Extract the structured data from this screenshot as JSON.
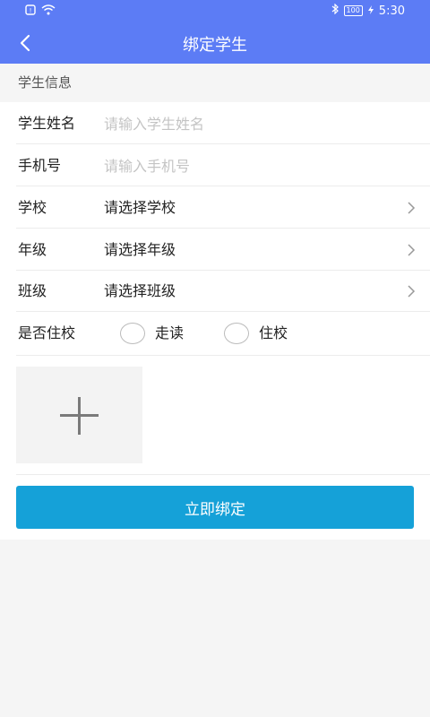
{
  "status_bar": {
    "battery": "100",
    "time": "5:30"
  },
  "nav": {
    "title": "绑定学生"
  },
  "section": {
    "title": "学生信息"
  },
  "form": {
    "name": {
      "label": "学生姓名",
      "placeholder": "请输入学生姓名"
    },
    "phone": {
      "label": "手机号",
      "placeholder": "请输入手机号"
    },
    "school": {
      "label": "学校",
      "value": "请选择学校"
    },
    "grade": {
      "label": "年级",
      "value": "请选择年级"
    },
    "class": {
      "label": "班级",
      "value": "请选择班级"
    },
    "boarding": {
      "label": "是否住校",
      "options": [
        "走读",
        "住校"
      ]
    }
  },
  "submit": {
    "label": "立即绑定"
  },
  "colors": {
    "primary": "#5c7cf5",
    "button": "#15a1d8"
  }
}
